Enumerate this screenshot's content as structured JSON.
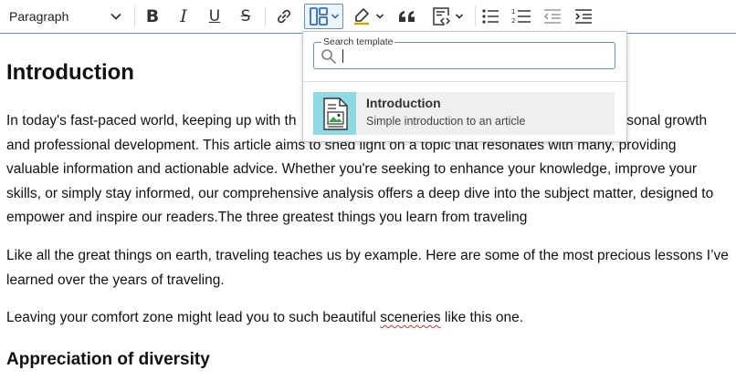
{
  "toolbar": {
    "paragraph_format": "Paragraph",
    "buttons": {
      "bold": "B",
      "italic": "I",
      "underline": "U",
      "strikethrough": "S"
    }
  },
  "template_panel": {
    "search_label": "Search template",
    "search_value": "",
    "templates": [
      {
        "title": "Introduction",
        "description": "Simple introduction to an article",
        "icon": "document-image-icon"
      }
    ]
  },
  "document": {
    "heading_intro": "Introduction",
    "p1_start": "In today's fast-paced world, keeping up with th",
    "p1_end": "ersonal growth and professional development. This article aims to shed light on a topic that resonates with many, providing valuable information and actionable advice. Whether you're seeking to enhance your knowledge, improve your skills, or simply stay informed, our comprehensive analysis offers a deep dive into the subject matter, designed to empower and inspire our readers.The three greatest things you learn from traveling",
    "p2": "Like all the great things on earth, traveling teaches us by example. Here are some of the most precious lessons I’ve learned over the years of traveling.",
    "p3_before": "Leaving your comfort zone might lead you to such beautiful ",
    "p3_misspelled": "sceneries",
    "p3_after": " like this one.",
    "heading_diversity": "Appreciation of diversity"
  },
  "colors": {
    "accent": "#5d94cf",
    "template_thumb": "#8fd9e4",
    "spellcheck": "#d93025"
  }
}
